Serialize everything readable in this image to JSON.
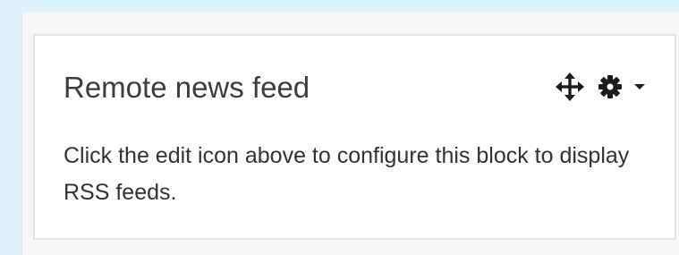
{
  "block": {
    "title": "Remote news feed",
    "content": "Click the edit icon above to configure this block to display RSS feeds.",
    "controls": {
      "move_icon": "move-arrows-icon",
      "actions_icon": "gear-icon",
      "menu_icon": "caret-down-icon"
    }
  },
  "colors": {
    "background": "#e0f2fb",
    "card": "#ffffff",
    "text": "#333333",
    "icon": "#1d1d1d"
  }
}
